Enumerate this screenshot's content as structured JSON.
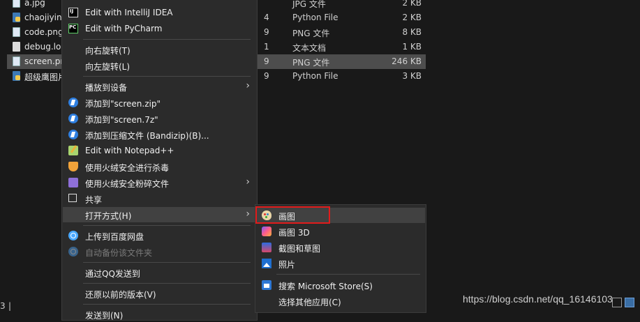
{
  "files": [
    {
      "name": "a.jpg",
      "icon": "image-file-icon",
      "num": "",
      "type": "JPG 文件",
      "size": "2 KB"
    },
    {
      "name": "chaojiyin",
      "icon": "python-file-icon",
      "num": "4",
      "type": "Python File",
      "size": "2 KB"
    },
    {
      "name": "code.png",
      "icon": "image-file-icon",
      "num": "9",
      "type": "PNG 文件",
      "size": "8 KB"
    },
    {
      "name": "debug.lo",
      "icon": "text-file-icon",
      "num": "1",
      "type": "文本文档",
      "size": "1 KB"
    },
    {
      "name": "screen.pn",
      "icon": "image-file-icon",
      "num": "9",
      "type": "PNG 文件",
      "size": "246 KB",
      "selected": true
    },
    {
      "name": "超级鹰图片",
      "icon": "python-file-icon",
      "num": "9",
      "type": "Python File",
      "size": "3 KB"
    }
  ],
  "status": {
    "count": "3",
    "separator": "|"
  },
  "watermark": "https://blog.csdn.net/qq_16146103",
  "context_menu": {
    "items": [
      {
        "label": "Edit with IntelliJ IDEA",
        "icon": "intellij-idea-icon"
      },
      {
        "label": "Edit with PyCharm",
        "icon": "pycharm-icon"
      },
      {
        "label": "向右旋转(T)",
        "icon": ""
      },
      {
        "label": "向左旋转(L)",
        "icon": ""
      },
      {
        "label": "播放到设备",
        "icon": "",
        "submenu": true
      },
      {
        "label": "添加到\"screen.zip\"",
        "icon": "bandizip-icon"
      },
      {
        "label": "添加到\"screen.7z\"",
        "icon": "bandizip-icon"
      },
      {
        "label": "添加到压缩文件 (Bandizip)(B)...",
        "icon": "bandizip-icon"
      },
      {
        "label": "Edit with Notepad++",
        "icon": "notepad-plus-plus-icon"
      },
      {
        "label": "使用火绒安全进行杀毒",
        "icon": "huorong-shield-icon"
      },
      {
        "label": "使用火绒安全粉碎文件",
        "icon": "huorong-shredder-icon",
        "submenu": true
      },
      {
        "label": "共享",
        "icon": "share-icon"
      },
      {
        "label": "打开方式(H)",
        "icon": "",
        "submenu": true,
        "hover": true
      },
      {
        "label": "上传到百度网盘",
        "icon": "baidu-netdisk-icon"
      },
      {
        "label": "自动备份该文件夹",
        "icon": "baidu-netdisk-icon",
        "disabled": true
      },
      {
        "label": "通过QQ发送到",
        "icon": ""
      },
      {
        "label": "还原以前的版本(V)",
        "icon": ""
      },
      {
        "label": "发送到(N)",
        "icon": ""
      }
    ]
  },
  "open_with_submenu": {
    "items": [
      {
        "label": "画图",
        "icon": "paint-icon",
        "hover": true,
        "highlighted": true
      },
      {
        "label": "画图 3D",
        "icon": "paint-3d-icon"
      },
      {
        "label": "截图和草图",
        "icon": "snip-sketch-icon"
      },
      {
        "label": "照片",
        "icon": "photos-icon"
      },
      {
        "label": "搜索 Microsoft Store(S)",
        "icon": "microsoft-store-icon"
      },
      {
        "label": "选择其他应用(C)",
        "icon": ""
      }
    ]
  },
  "colors": {
    "background": "#191919",
    "menu": "#2b2b2b",
    "hover": "#414141",
    "selected_row": "#4d4d4d",
    "highlight_box": "#e21b1b"
  }
}
